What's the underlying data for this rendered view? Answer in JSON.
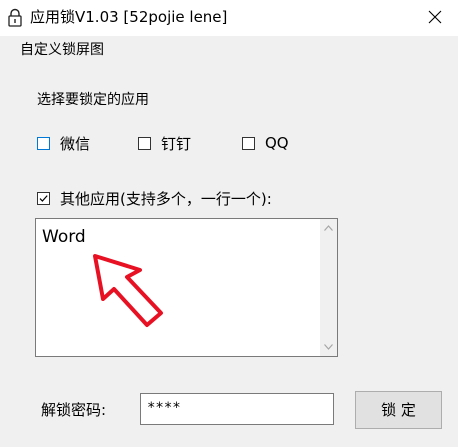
{
  "window": {
    "title": "应用锁V1.03 [52pojie lene]",
    "app_icon": "padlock-icon",
    "close_icon": "close-icon"
  },
  "menu": {
    "items": [
      "自定义锁屏图"
    ]
  },
  "main": {
    "select_label": "选择要锁定的应用",
    "apps": [
      {
        "label": "微信",
        "checked": false
      },
      {
        "label": "钉钉",
        "checked": false
      },
      {
        "label": "QQ",
        "checked": false
      }
    ],
    "other_apps": {
      "label": "其他应用(支持多个，一行一个):",
      "checked": true,
      "value": "Word"
    }
  },
  "footer": {
    "password_label": "解锁密码:",
    "password_value": "****",
    "lock_button_label": "锁 定"
  },
  "colors": {
    "window_bg": "#f0f0f0",
    "title_bg": "#ffffff",
    "focus_border": "#0078d7",
    "annotation_arrow": "#e81123"
  }
}
